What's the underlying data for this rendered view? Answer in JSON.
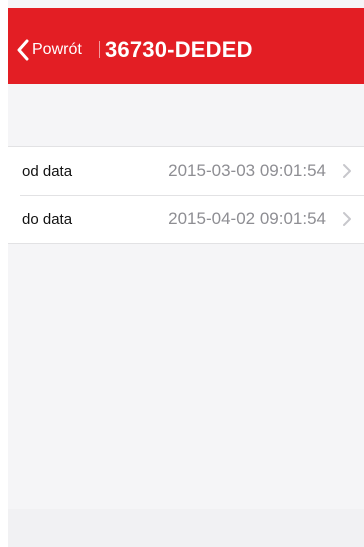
{
  "nav": {
    "back_label": "Powrót",
    "title": "36730-DEDED",
    "bar_color": "#e31e24"
  },
  "filters": [
    {
      "label": "od data",
      "value": "2015-03-03 09:01:54"
    },
    {
      "label": "do data",
      "value": "2015-04-02 09:01:54"
    }
  ],
  "icons": {
    "back": "chevron-left-icon",
    "row_disclosure": "chevron-right-icon"
  }
}
